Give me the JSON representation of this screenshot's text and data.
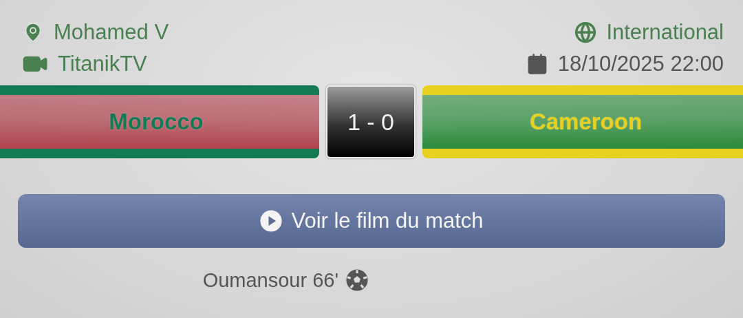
{
  "venue": "Mohamed V",
  "broadcaster": "TitanikTV",
  "competition": "International",
  "datetime": "18/10/2025 22:00",
  "home": {
    "name": "Morocco",
    "band": {
      "color": "#b0434d"
    },
    "stripe": {
      "color": "#137a55"
    },
    "goals": [
      {
        "text": "Oumansour 66'"
      }
    ]
  },
  "score": "1 - 0",
  "away": {
    "name": "Cameroon",
    "band": {
      "color": "#2a8a3a"
    },
    "stripe": {
      "color": "#e8d020"
    }
  },
  "video_button": {
    "label": "Voir le film du match"
  }
}
